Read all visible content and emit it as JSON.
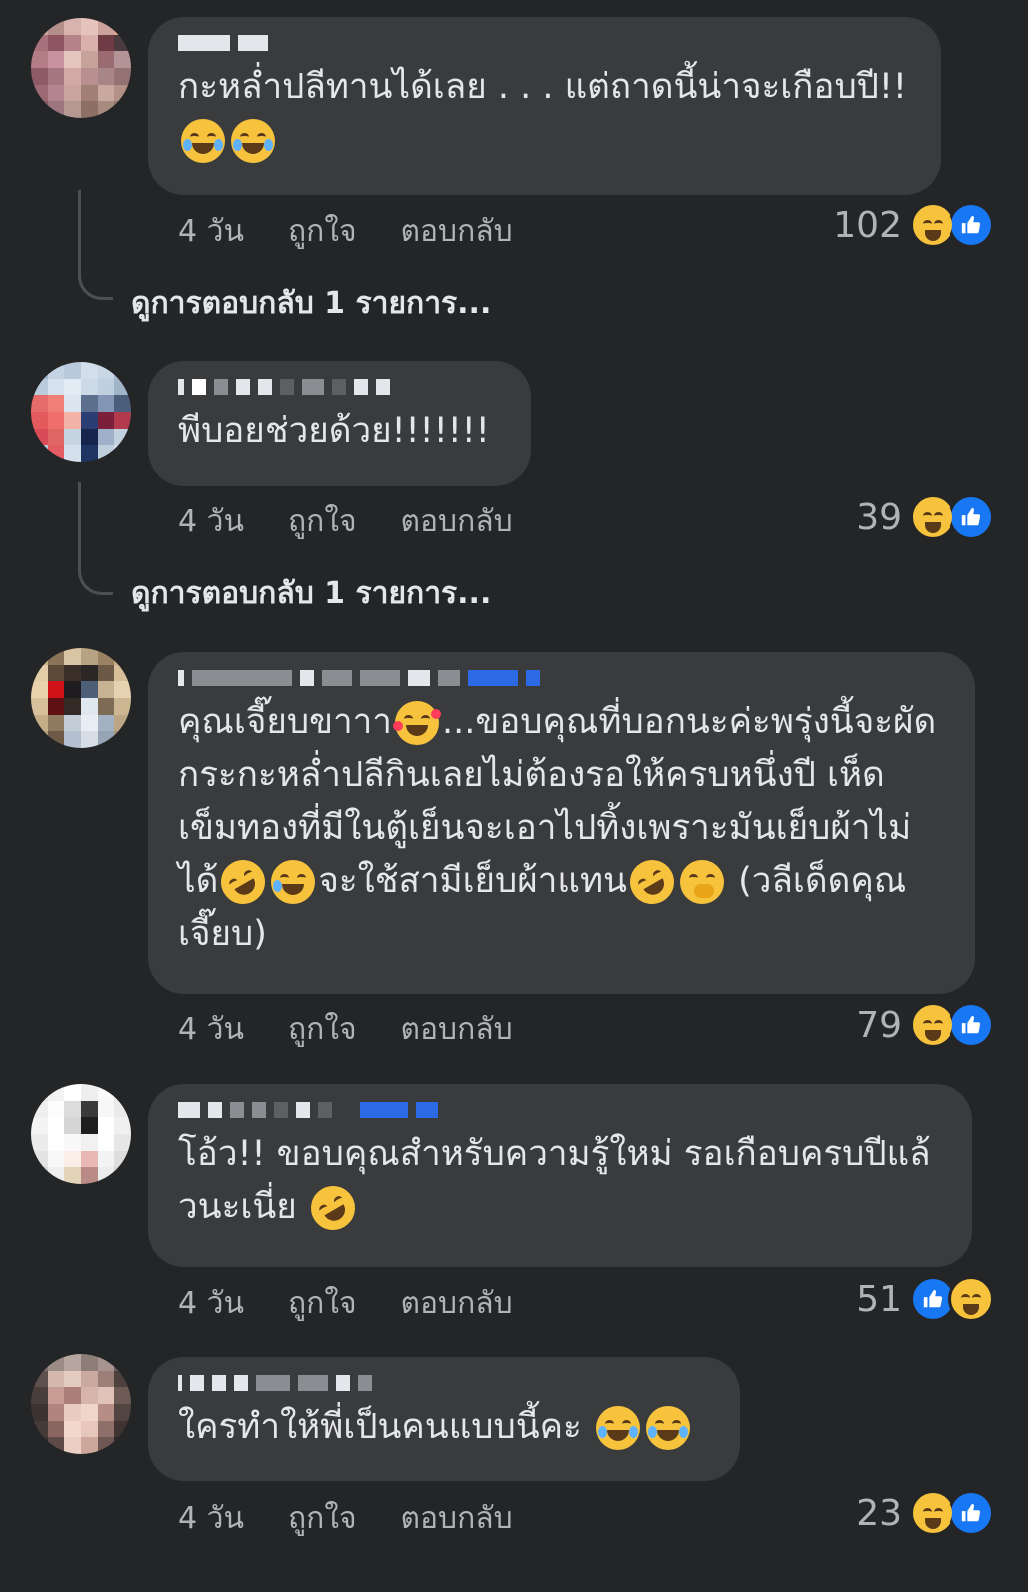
{
  "comments": [
    {
      "text": "กะหล่ำปลีทานได้เลย . . . แต่ถาดนี้น่าจะเกือบปี!!",
      "emojis": [
        "joy-tears-emoji",
        "joy-tears-emoji"
      ],
      "time": "4 วัน",
      "like_label": "ถูกใจ",
      "reply_label": "ตอบกลับ",
      "reaction_count": "102",
      "reactions": [
        "haha",
        "like"
      ],
      "view_replies": "ดูการตอบกลับ 1 รายการ..."
    },
    {
      "text": "พีบอยช่วยด้วย!!!!!!!",
      "time": "4 วัน",
      "like_label": "ถูกใจ",
      "reply_label": "ตอบกลับ",
      "reaction_count": "39",
      "reactions": [
        "haha",
        "like"
      ],
      "view_replies": "ดูการตอบกลับ 1 รายการ..."
    },
    {
      "text_lines": [
        "คุณเจี๊ยบขาาา",
        "...ขอบคุณที่บอกนะค่ะพรุ่งนี้จะผัด",
        "กระกะหล่ำปลีกินเลยไม่ต้องรอให้ครบหนึ่งปี เห็ด",
        "เข็มทองที่มีในตู้เย็นจะเอาไปทิ้งเพราะมันเย็บผ้าไม่",
        "ได้",
        "จะใช้สามีเย็บผ้าแทน",
        "(วลีเด็ดคุณ",
        "เจี๊ยบ)"
      ],
      "time": "4 วัน",
      "like_label": "ถูกใจ",
      "reply_label": "ตอบกลับ",
      "reaction_count": "79",
      "reactions": [
        "haha",
        "like"
      ]
    },
    {
      "text_lines": [
        "โอ้ว!! ขอบคุณสำหรับความรู้ใหม่ รอเกือบครบปีแล้",
        "วนะเนี่ย"
      ],
      "time": "4 วัน",
      "like_label": "ถูกใจ",
      "reply_label": "ตอบกลับ",
      "reaction_count": "51",
      "reactions": [
        "like",
        "haha"
      ]
    },
    {
      "text": "ใครทำให้พี่เป็นคนแบบนี้คะ",
      "time": "4 วัน",
      "like_label": "ถูกใจ",
      "reply_label": "ตอบกลับ",
      "reaction_count": "23",
      "reactions": [
        "haha",
        "like"
      ]
    }
  ],
  "colors": {
    "background": "#242526",
    "bubble": "#3a3b3c",
    "text": "#e4e6eb",
    "meta": "#b0b3b8",
    "like_blue": "#1877f2",
    "haha_yellow": "#f7c33c"
  }
}
